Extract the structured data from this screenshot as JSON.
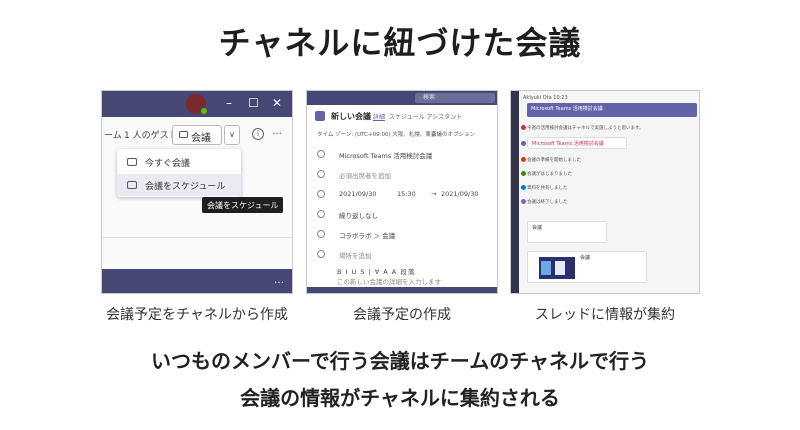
{
  "title": "チャネルに紐づけた会議",
  "captions": {
    "left": "会議予定をチャネルから作成",
    "center": "会議予定の作成",
    "right": "スレッドに情報が集約"
  },
  "bottom": {
    "line1": "いつものメンバーで行う会議はチームのチャネルで行う",
    "line2": "会議の情報がチャネルに集約される"
  },
  "panel1": {
    "toolbar_left": "ーム",
    "guests": "1 人のゲスト",
    "meet_label": "会議",
    "menu_items": [
      "今すぐ会議",
      "会議をスケジュール"
    ],
    "tooltip": "会議をスケジュール",
    "more": "…",
    "footer_more": "…",
    "colors": {
      "bar": "#464775"
    }
  },
  "panel2": {
    "search_placeholder": "検索",
    "new_meeting": "新しい会議",
    "detail_tab": "詳細",
    "assistant_tab": "スケジュール アシスタント",
    "timezone": "タイム ゾーン: (UTC+09:00) 大阪、札幌、東京",
    "options": "会議のオプション",
    "meeting_title": "Microsoft Teams 活用検討会議",
    "add_attendee": "必須出席者を追加",
    "date_start": "2021/09/30",
    "time_start": "15:30",
    "date_end": "2021/09/30",
    "repeat": "繰り返しなし",
    "channel": "コラボラボ ＞ 会議",
    "location": "場所を追加",
    "format_bar": "B  I  U  S  |  ∀  A  A  段落",
    "detail_placeholder": "この新しい会議の詳細を入力します"
  },
  "panel3": {
    "header": "Akiyuki Ota  10:23",
    "banner_title": "Microsoft Teams 活用検討会議",
    "messages": [
      "今週の活用検討会議はチャネルで実施しようと思います。",
      "Microsoft Teams 活用検討会議",
      "会議の準備を開始しました",
      "会議がはじまりました",
      "資料を共有しました",
      "会議は終了しました"
    ],
    "card_label": "会議",
    "thumb_label": "会議"
  }
}
